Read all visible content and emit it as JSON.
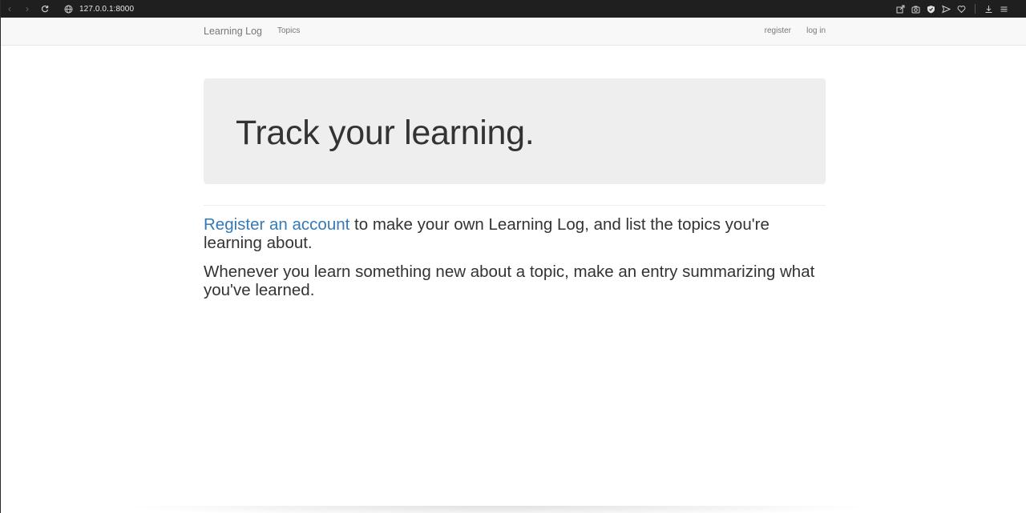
{
  "browser": {
    "url": "127.0.0.1:8000",
    "icons": [
      "back-icon",
      "forward-icon",
      "reload-icon",
      "site-info-icon",
      "share-icon",
      "screenshot-icon",
      "shield-icon",
      "send-icon",
      "heart-icon",
      "download-icon",
      "menu-icon"
    ]
  },
  "navbar": {
    "brand": "Learning Log",
    "topics": "Topics",
    "register": "register",
    "login": "log in"
  },
  "jumbotron": {
    "heading": "Track your learning."
  },
  "content": {
    "register_link": "Register an account",
    "p1_rest": " to make your own Learning Log, and list the topics you're learning about.",
    "p2": "Whenever you learn something new about a topic, make an entry summarizing what you've learned."
  },
  "colors": {
    "link": "#337ab7",
    "text": "#333333",
    "jumbotron_bg": "#eeeeee",
    "navbar_bg": "#f8f8f8"
  }
}
